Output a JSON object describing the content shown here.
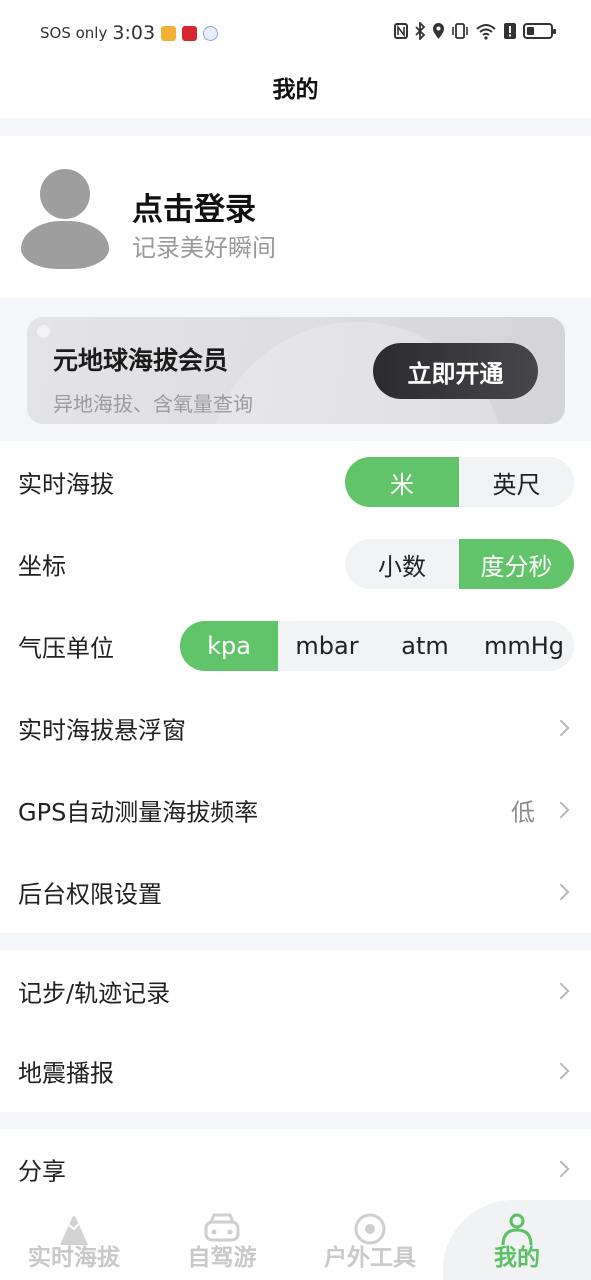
{
  "statusbar": {
    "carrier": "SOS only",
    "time": "3:03"
  },
  "header": {
    "title": "我的"
  },
  "profile": {
    "login_title": "点击登录",
    "login_subtitle": "记录美好瞬间"
  },
  "vip": {
    "title": "元地球海拔会员",
    "subtitle": "异地海拔、含氧量查询",
    "button": "立即开通"
  },
  "settings": {
    "altitude": {
      "label": "实时海拔",
      "options": [
        "米",
        "英尺"
      ],
      "selected": "米"
    },
    "coordinate": {
      "label": "坐标",
      "options": [
        "小数",
        "度分秒"
      ],
      "selected": "度分秒"
    },
    "pressure": {
      "label": "气压单位",
      "options": [
        "kpa",
        "mbar",
        "atm",
        "mmHg"
      ],
      "selected": "kpa"
    },
    "floating_window": {
      "label": "实时海拔悬浮窗"
    },
    "gps_frequency": {
      "label": "GPS自动测量海拔频率",
      "value": "低"
    },
    "background_permission": {
      "label": "后台权限设置"
    }
  },
  "group2": {
    "track": {
      "label": "记步/轨迹记录"
    },
    "earthquake": {
      "label": "地震播报"
    }
  },
  "group3": {
    "share": {
      "label": "分享"
    }
  },
  "tabbar": {
    "tabs": [
      {
        "label": "实时海拔",
        "icon": "mountain-icon"
      },
      {
        "label": "自驾游",
        "icon": "car-icon"
      },
      {
        "label": "户外工具",
        "icon": "compass-icon"
      },
      {
        "label": "我的",
        "icon": "user-icon"
      }
    ],
    "active": "我的",
    "accent": "#5cc164"
  }
}
